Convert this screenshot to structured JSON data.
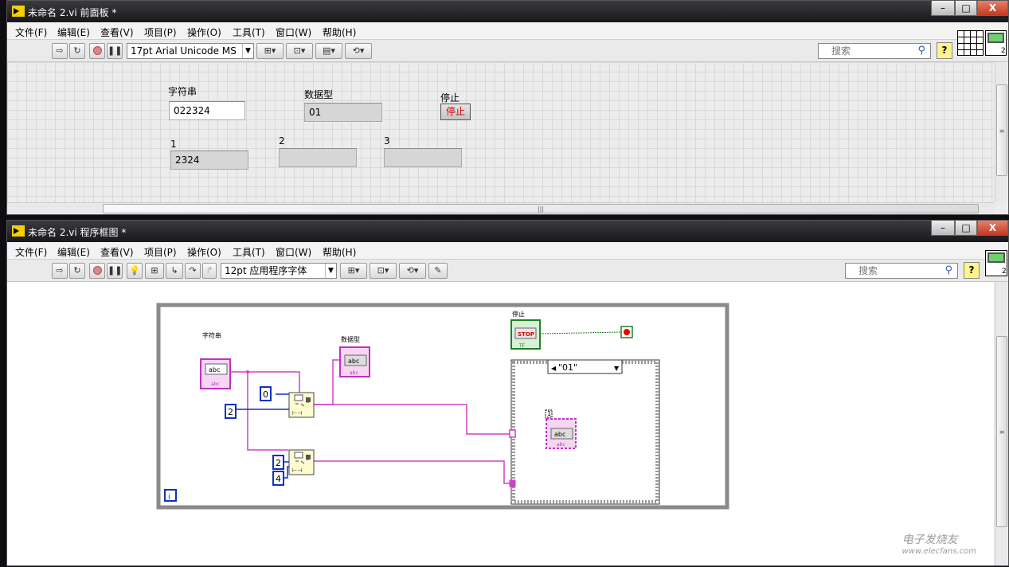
{
  "front_panel": {
    "title": "未命名 2.vi 前面板 *",
    "menu": [
      "文件(F)",
      "编辑(E)",
      "查看(V)",
      "项目(P)",
      "操作(O)",
      "工具(T)",
      "窗口(W)",
      "帮助(H)"
    ],
    "font_selector": "17pt Arial Unicode MS",
    "search_placeholder": "搜索",
    "controls": {
      "string_label": "字符串",
      "string_value": "022324",
      "numeric_label": "数据型",
      "numeric_value": "01",
      "stop_label": "停止",
      "stop_button": "停止",
      "out1_label": "1",
      "out1_value": "2324",
      "out2_label": "2",
      "out2_value": "",
      "out3_label": "3",
      "out3_value": ""
    }
  },
  "block_diagram": {
    "title": "未命名 2.vi 程序框图 *",
    "menu": [
      "文件(F)",
      "编辑(E)",
      "查看(V)",
      "项目(P)",
      "操作(O)",
      "工具(T)",
      "窗口(W)",
      "帮助(H)"
    ],
    "font_selector": "12pt 应用程序字体",
    "search_placeholder": "搜索",
    "nodes": {
      "string_terminal_label": "字符串",
      "string_terminal_text": "abc",
      "string_terminal_sub": "abc",
      "numeric_indicator_label": "数据型",
      "numeric_indicator_text": "abc",
      "numeric_indicator_sub": "abc",
      "stop_label": "停止",
      "stop_text": "STOP",
      "stop_sub": "TF",
      "const_0": "0",
      "const_2a": "2",
      "const_2b": "2",
      "const_4": "4",
      "case_selector": "\"01\"",
      "inner_label": "1",
      "inner_text": "abc",
      "inner_sub": "abc",
      "loop_index": "i"
    }
  },
  "window_controls": {
    "minimize": "–",
    "maximize": "□",
    "close": "X"
  },
  "watermark": {
    "main": "电子发烧友",
    "url": "www.elecfans.com"
  }
}
